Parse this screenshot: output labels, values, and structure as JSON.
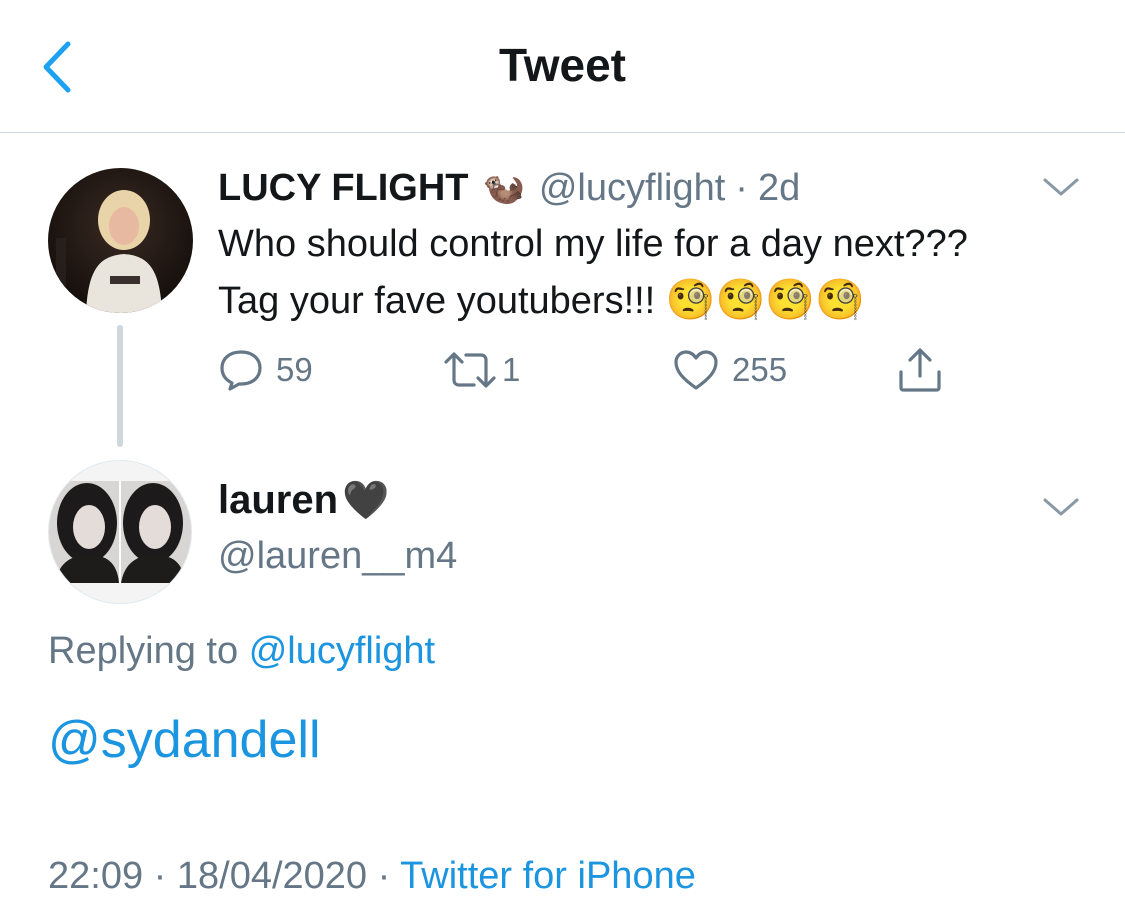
{
  "header": {
    "title": "Tweet"
  },
  "parent_tweet": {
    "display_name": "LUCY FLIGHT",
    "name_emoji": "🦦",
    "handle": "@lucyflight",
    "separator": "·",
    "age": "2d",
    "text_line1": "Who should control my life for a day next???",
    "text_line2": "Tag your fave youtubers!!!",
    "emojis": "🧐🧐🧐🧐",
    "replies": "59",
    "retweets": "1",
    "likes": "255"
  },
  "reply_tweet": {
    "display_name": "lauren",
    "name_emoji": "🖤",
    "handle": "@lauren__m4",
    "replying_prefix": "Replying to",
    "replying_handle": "@lucyflight",
    "body": "@sydandell",
    "time": "22:09",
    "sep1": "·",
    "date": "18/04/2020",
    "sep2": "·",
    "source": "Twitter for iPhone"
  },
  "colors": {
    "link": "#1b95e0",
    "muted": "#657786",
    "text": "#14171a",
    "divider": "#cfd6dc"
  },
  "icons": [
    "back-chevron-icon",
    "chevron-down-icon",
    "reply-icon",
    "retweet-icon",
    "heart-icon",
    "share-icon"
  ]
}
